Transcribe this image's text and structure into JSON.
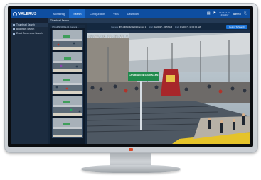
{
  "app": {
    "brand": "VALERUS"
  },
  "nav": {
    "tabs": [
      {
        "label": "Monitoring"
      },
      {
        "label": "Search"
      },
      {
        "label": "Configuration"
      },
      {
        "label": "VMS"
      },
      {
        "label": "Dashboard"
      }
    ],
    "active_tab": "Search",
    "time": [
      "10:43:17 AM",
      "4/4/2017"
    ],
    "user": "admin ▾"
  },
  "sidebar": {
    "items": [
      {
        "label": "Thumbnail Search",
        "icon": "grid-icon"
      },
      {
        "label": "Bookmark Search",
        "icon": "bookmark-icon"
      },
      {
        "label": "Event Occurrence Search",
        "icon": "event-icon"
      }
    ]
  },
  "search": {
    "title": "Thumbnail Search"
  },
  "viewer": {
    "camera_label": "Camera:",
    "camera_value": "IPC-HDW4421E-01 Camera 1",
    "start_label": "Start:",
    "start_value": "4/1/2017 - 09:57 AM",
    "end_label": "End:",
    "end_value": "4/1/2017 - 10:00:00 AM",
    "button": "Return To Search",
    "timestamp": "03/01/16 11:28:21 A",
    "banner": "LA VIRGEN DE GUADALUPE"
  },
  "colors": {
    "topbar": "#0e4ea0",
    "active_tab": "#1a68c8",
    "sidebar": "#1c2c40",
    "accent_button": "#1a72d6"
  }
}
